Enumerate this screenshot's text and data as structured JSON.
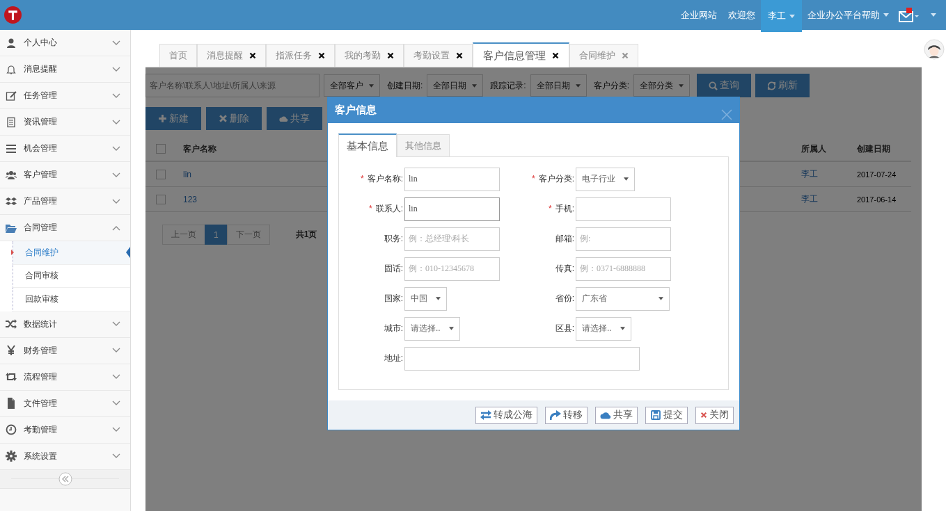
{
  "header": {
    "links": [
      {
        "label": "企业网站",
        "selected": false,
        "dropdown": false
      },
      {
        "label": "欢迎您",
        "selected": false,
        "dropdown": false
      },
      {
        "label": "李工",
        "selected": true,
        "dropdown": true
      },
      {
        "label": "企业办公平台帮助",
        "selected": false,
        "dropdown": true
      }
    ]
  },
  "sidebar": {
    "items": [
      {
        "label": "个人中心",
        "expanded": false
      },
      {
        "label": "消息提醒",
        "expanded": false
      },
      {
        "label": "任务管理",
        "expanded": false
      },
      {
        "label": "资讯管理",
        "expanded": false
      },
      {
        "label": "机会管理",
        "expanded": false
      },
      {
        "label": "客户管理",
        "expanded": false
      },
      {
        "label": "产品管理",
        "expanded": false
      },
      {
        "label": "合同管理",
        "expanded": true,
        "children": [
          {
            "label": "合同维护",
            "selected": true
          },
          {
            "label": "合同审核",
            "selected": false
          },
          {
            "label": "回款审核",
            "selected": false
          }
        ]
      },
      {
        "label": "数据统计",
        "expanded": false
      },
      {
        "label": "财务管理",
        "expanded": false
      },
      {
        "label": "流程管理",
        "expanded": false
      },
      {
        "label": "文件管理",
        "expanded": false
      },
      {
        "label": "考勤管理",
        "expanded": false
      },
      {
        "label": "系统设置",
        "expanded": false
      }
    ]
  },
  "tabs": [
    {
      "label": "首页",
      "selected": false,
      "closable": false
    },
    {
      "label": "消息提醒",
      "selected": false,
      "closable": true
    },
    {
      "label": "指派任务",
      "selected": false,
      "closable": true
    },
    {
      "label": "我的考勤",
      "selected": false,
      "closable": true
    },
    {
      "label": "考勤设置",
      "selected": false,
      "closable": true
    },
    {
      "label": "客户信息管理",
      "selected": true,
      "closable": true
    },
    {
      "label": "合同维护",
      "selected": false,
      "closable": true
    }
  ],
  "filters": {
    "search": {
      "placeholder": "客户名称\\联系人\\地址\\所属人\\来源"
    },
    "items": [
      {
        "value": "全部客户"
      },
      {
        "label": "创建日期:",
        "value": "全部日期"
      },
      {
        "label": "跟踪记录:",
        "value": "全部日期"
      },
      {
        "label": "客户分类:",
        "value": "全部分类"
      }
    ],
    "buttons": [
      "查询",
      "刷新"
    ]
  },
  "toolbar": [
    "新建",
    "删除",
    "共享"
  ],
  "table": {
    "all_selected": false,
    "columns": [
      "客户名称",
      "所属人",
      "创建日期"
    ],
    "rows": [
      {
        "name": "lin",
        "owner": "李工",
        "date": "2017-07-24",
        "selected": false
      },
      {
        "name": "123",
        "owner": "李工",
        "date": "2017-06-14",
        "selected": false
      }
    ]
  },
  "pagination": {
    "prev": "上一页",
    "pages": [
      {
        "label": "1",
        "selected": true
      }
    ],
    "next": "下一页",
    "total": "共1页"
  },
  "dialog": {
    "title": "客户信息",
    "tabs": [
      {
        "label": "基本信息",
        "selected": true
      },
      {
        "label": "其他信息",
        "selected": false
      }
    ],
    "rows": [
      {
        "fields": [
          {
            "label": "客户名称:",
            "required_mark": "*",
            "kind": "input",
            "value": "lin"
          },
          {
            "label": "客户分类:",
            "required_mark": "*",
            "kind": "select",
            "value": "电子行业"
          }
        ]
      },
      {
        "fields": [
          {
            "label": "联系人:",
            "required_mark": "*",
            "kind": "input",
            "value": "lin"
          },
          {
            "label": "手机:",
            "required_mark": "*",
            "kind": "input"
          }
        ]
      },
      {
        "fields": [
          {
            "label": "职务:",
            "kind": "input",
            "placeholder": "例：总经理\\科长"
          },
          {
            "label": "邮箱:",
            "kind": "input",
            "placeholder": "例:"
          }
        ]
      },
      {
        "fields": [
          {
            "label": "固话:",
            "kind": "input",
            "placeholder": "例：010-12345678"
          },
          {
            "label": "传真:",
            "kind": "input",
            "placeholder": "例：0371-6888888"
          }
        ]
      },
      {
        "fields": [
          {
            "label": "国家:",
            "kind": "select",
            "value": "中国"
          },
          {
            "label": "省份:",
            "kind": "select",
            "value": "广东省"
          }
        ]
      },
      {
        "fields": [
          {
            "label": "城市:",
            "kind": "select",
            "value": "请选择.."
          },
          {
            "label": "区县:",
            "kind": "select",
            "value": "请选择.."
          }
        ]
      },
      {
        "fields": [
          {
            "label": "地址:",
            "kind": "input"
          }
        ]
      }
    ],
    "buttons": [
      {
        "label": "转成公海",
        "kind": "exchange"
      },
      {
        "label": "转移",
        "kind": "share"
      },
      {
        "label": "共享",
        "kind": "cloud"
      },
      {
        "label": "提交",
        "kind": "save"
      },
      {
        "label": "关闭",
        "kind": "close"
      }
    ]
  }
}
